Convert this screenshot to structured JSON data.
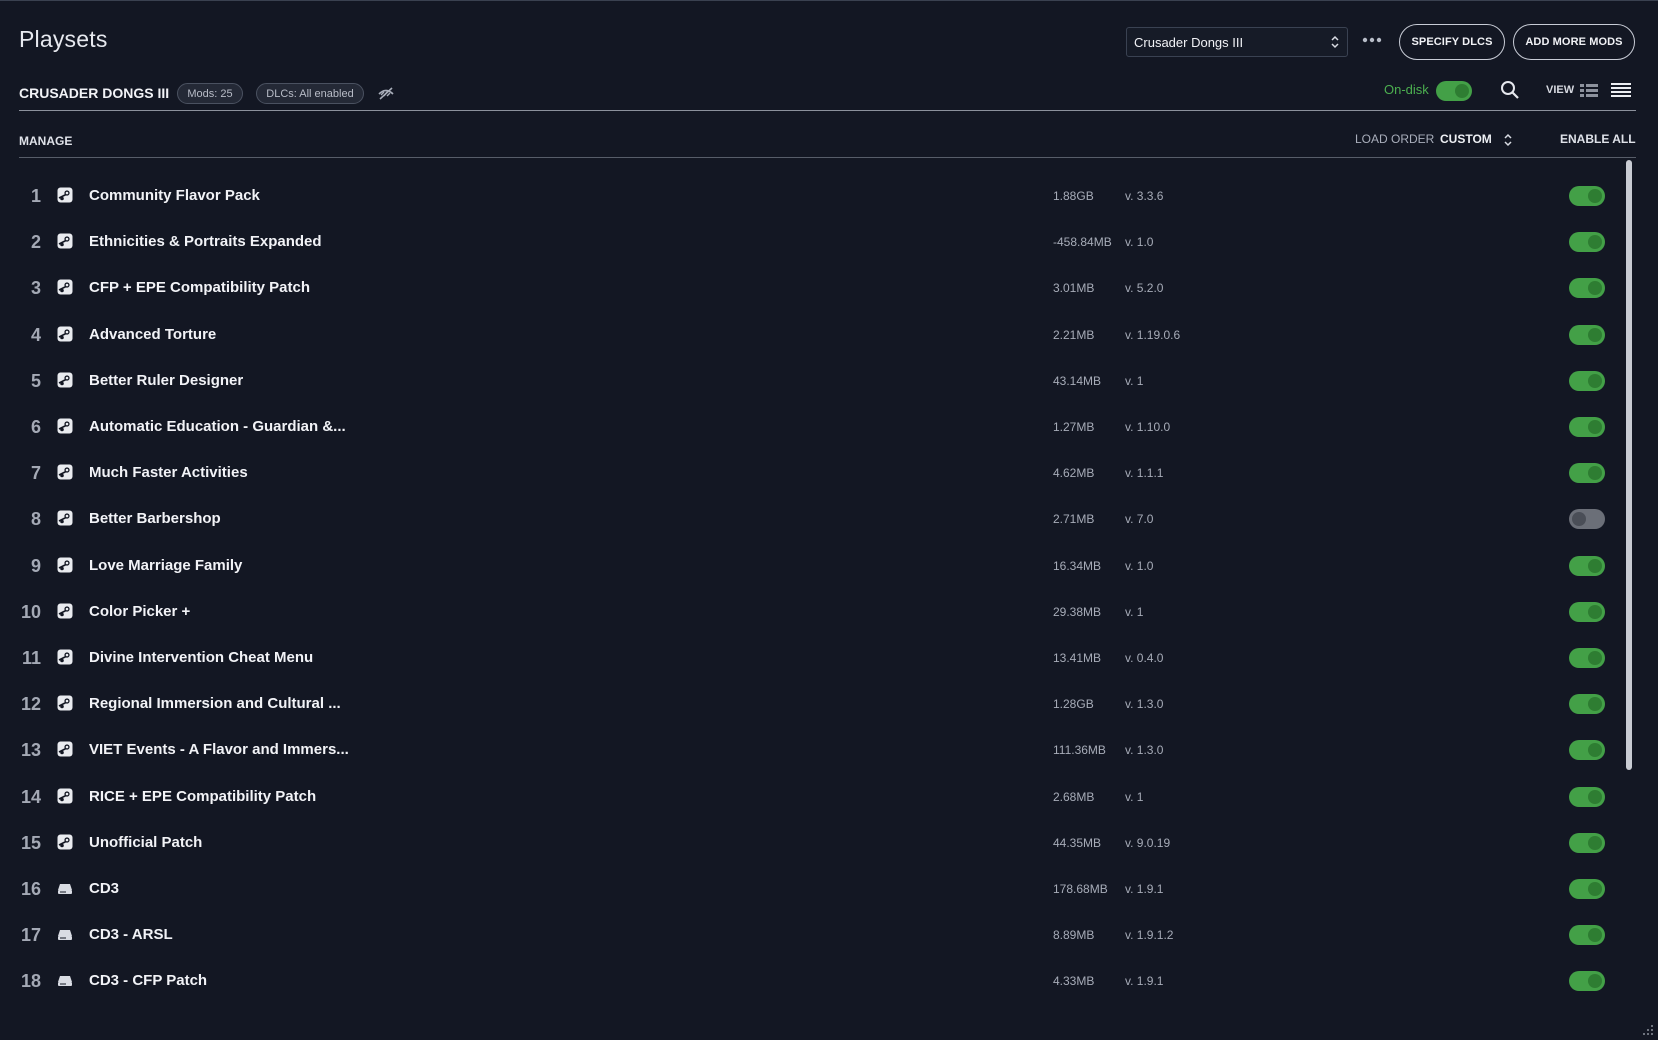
{
  "header": {
    "title": "Playsets",
    "playset_select": "Crusader Dongs III",
    "more_icon": "more-horizontal-icon",
    "specify_dlcs": "SPECIFY DLCS",
    "add_more_mods": "ADD MORE MODS"
  },
  "subheader": {
    "playset_name": "CRUSADER DONGS III",
    "mods_badge": "Mods: 25",
    "dlc_badge": "DLCs: All enabled",
    "ondisk_label": "On-disk",
    "ondisk_enabled": true,
    "view_label": "VIEW"
  },
  "columns": {
    "manage": "MANAGE",
    "load_order": "LOAD ORDER",
    "sort_mode": "CUSTOM",
    "enable_all": "ENABLE ALL"
  },
  "colors": {
    "background": "#131723",
    "accent_green": "#43a047",
    "toggle_off": "#6b6f78"
  },
  "mods": [
    {
      "num": "1",
      "name": "Community Flavor Pack",
      "size": "1.88GB",
      "version": "v. 3.3.6",
      "source": "steam",
      "enabled": true
    },
    {
      "num": "2",
      "name": "Ethnicities & Portraits Expanded",
      "size": "-458.84MB",
      "version": "v. 1.0",
      "source": "steam",
      "enabled": true
    },
    {
      "num": "3",
      "name": "CFP + EPE Compatibility Patch",
      "size": "3.01MB",
      "version": "v. 5.2.0",
      "source": "steam",
      "enabled": true
    },
    {
      "num": "4",
      "name": "Advanced Torture",
      "size": "2.21MB",
      "version": "v. 1.19.0.6",
      "source": "steam",
      "enabled": true
    },
    {
      "num": "5",
      "name": "Better Ruler Designer",
      "size": "43.14MB",
      "version": "v. 1",
      "source": "steam",
      "enabled": true
    },
    {
      "num": "6",
      "name": "Automatic Education - Guardian &...",
      "size": "1.27MB",
      "version": "v. 1.10.0",
      "source": "steam",
      "enabled": true
    },
    {
      "num": "7",
      "name": "Much Faster Activities",
      "size": "4.62MB",
      "version": "v. 1.1.1",
      "source": "steam",
      "enabled": true
    },
    {
      "num": "8",
      "name": "Better Barbershop",
      "size": "2.71MB",
      "version": "v. 7.0",
      "source": "steam",
      "enabled": false
    },
    {
      "num": "9",
      "name": "Love Marriage Family",
      "size": "16.34MB",
      "version": "v. 1.0",
      "source": "steam",
      "enabled": true
    },
    {
      "num": "10",
      "name": "Color Picker +",
      "size": "29.38MB",
      "version": "v. 1",
      "source": "steam",
      "enabled": true
    },
    {
      "num": "11",
      "name": "Divine Intervention Cheat Menu",
      "size": "13.41MB",
      "version": "v. 0.4.0",
      "source": "steam",
      "enabled": true
    },
    {
      "num": "12",
      "name": "Regional Immersion and Cultural ...",
      "size": "1.28GB",
      "version": "v. 1.3.0",
      "source": "steam",
      "enabled": true
    },
    {
      "num": "13",
      "name": "VIET Events - A Flavor and Immers...",
      "size": "111.36MB",
      "version": "v. 1.3.0",
      "source": "steam",
      "enabled": true
    },
    {
      "num": "14",
      "name": "RICE + EPE Compatibility Patch",
      "size": "2.68MB",
      "version": "v. 1",
      "source": "steam",
      "enabled": true
    },
    {
      "num": "15",
      "name": "Unofficial Patch",
      "size": "44.35MB",
      "version": "v. 9.0.19",
      "source": "steam",
      "enabled": true
    },
    {
      "num": "16",
      "name": "CD3",
      "size": "178.68MB",
      "version": "v. 1.9.1",
      "source": "local",
      "enabled": true
    },
    {
      "num": "17",
      "name": "CD3 - ARSL",
      "size": "8.89MB",
      "version": "v. 1.9.1.2",
      "source": "local",
      "enabled": true
    },
    {
      "num": "18",
      "name": "CD3 - CFP Patch",
      "size": "4.33MB",
      "version": "v. 1.9.1",
      "source": "local",
      "enabled": true
    }
  ]
}
